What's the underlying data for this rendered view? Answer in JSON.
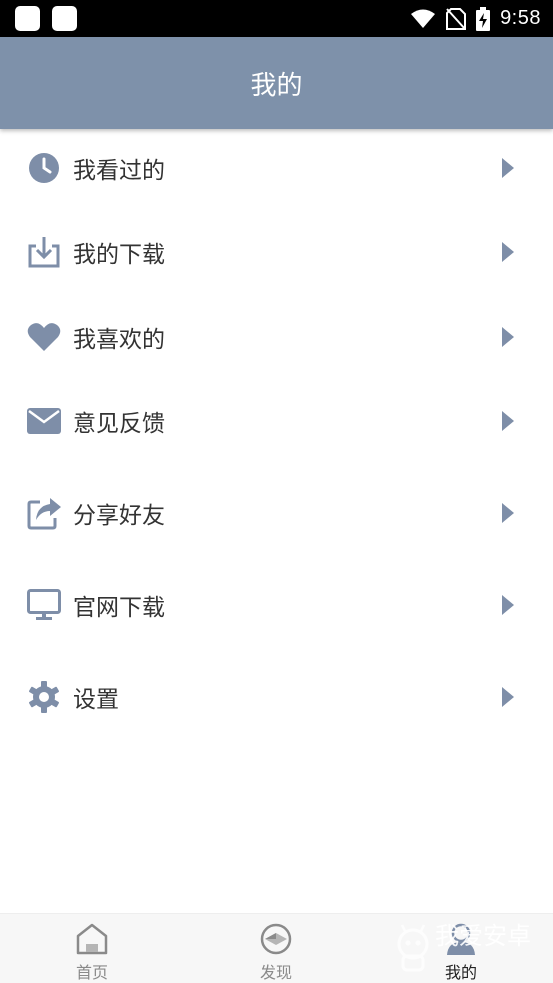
{
  "status_bar": {
    "time": "9:58",
    "icons": [
      "wifi-icon",
      "no-sim-icon",
      "battery-charging-icon"
    ]
  },
  "header": {
    "title": "我的"
  },
  "menu": {
    "items": [
      {
        "label": "我看过的",
        "icon": "history-clock-icon"
      },
      {
        "label": "我的下载",
        "icon": "download-icon"
      },
      {
        "label": "我喜欢的",
        "icon": "heart-icon"
      },
      {
        "label": "意见反馈",
        "icon": "mail-icon"
      },
      {
        "label": "分享好友",
        "icon": "share-icon"
      },
      {
        "label": "官网下载",
        "icon": "monitor-icon"
      },
      {
        "label": "设置",
        "icon": "gear-icon"
      }
    ]
  },
  "bottom_nav": {
    "items": [
      {
        "label": "首页",
        "icon": "home-icon",
        "active": false
      },
      {
        "label": "发现",
        "icon": "discover-icon",
        "active": false
      },
      {
        "label": "我的",
        "icon": "profile-icon",
        "active": true
      }
    ]
  },
  "watermark": {
    "brand": "我爱安卓"
  },
  "colors": {
    "header_bg": "#7e91aa",
    "icon": "#7e8ea8",
    "label": "#333333",
    "nav_label": "#8a8a8a"
  }
}
